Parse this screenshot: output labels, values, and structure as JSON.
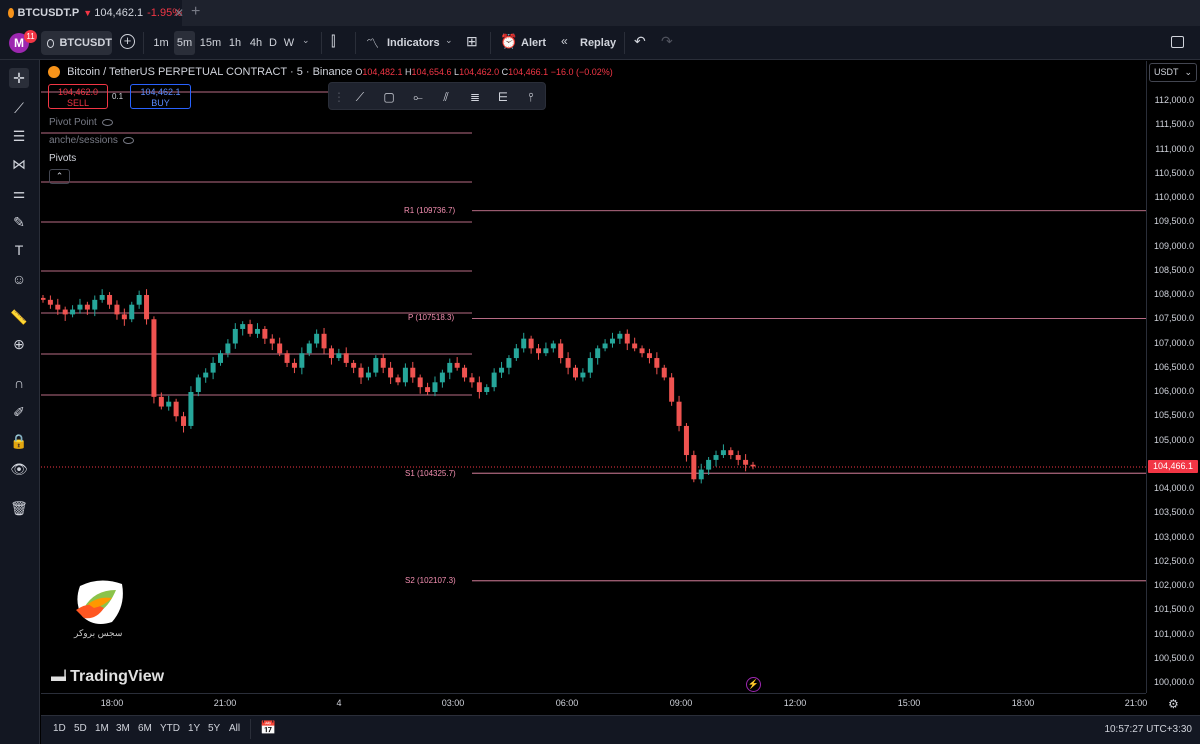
{
  "tab": {
    "symbol": "BTCUSDT.P",
    "price": "104,462.1",
    "change": "-1.95%"
  },
  "toolbar": {
    "avatar_letter": "M",
    "notification_count": "11",
    "symbol": "BTCUSDT",
    "intervals": [
      "1m",
      "5m",
      "15m",
      "1h",
      "4h",
      "D",
      "W"
    ],
    "active_interval": "5m",
    "indicators_label": "Indicators",
    "alert_label": "Alert",
    "replay_label": "Replay"
  },
  "legend": {
    "title": "Bitcoin / TetherUS PERPETUAL CONTRACT · 5 · Binance",
    "open_label": "O",
    "open": "104,482.1",
    "high_label": "H",
    "high": "104,654.6",
    "low_label": "L",
    "low": "104,462.0",
    "close_label": "C",
    "close": "104,466.1",
    "change": "−16.0 (−0.02%)"
  },
  "trade": {
    "sell_price": "104,462.0",
    "sell_label": "SELL",
    "buy_price": "104,462.1",
    "buy_label": "BUY",
    "quantity": "0.1"
  },
  "indicators": [
    "Pivot Point",
    "anche/sessions",
    "Pivots"
  ],
  "currency": "USDT",
  "current_price": "104,466.1",
  "pivots": [
    {
      "label": "R1 (109736.7)",
      "value": 109736.7
    },
    {
      "label": "P (107518.3)",
      "value": 107518.3
    },
    {
      "label": "S1 (104325.7)",
      "value": 104325.7
    },
    {
      "label": "S2 (102107.3)",
      "value": 102107.3
    }
  ],
  "chart_data": {
    "type": "candlestick",
    "title": "Bitcoin / TetherUS PERPETUAL CONTRACT · 5 · Binance",
    "y_ticks": [
      "112,000.0",
      "111,500.0",
      "111,000.0",
      "110,500.0",
      "110,000.0",
      "109,500.0",
      "109,000.0",
      "108,500.0",
      "108,000.0",
      "107,500.0",
      "107,000.0",
      "106,500.0",
      "106,000.0",
      "105,500.0",
      "105,000.0",
      "104,500.0",
      "104,000.0",
      "103,500.0",
      "103,000.0",
      "102,500.0",
      "102,000.0",
      "101,500.0",
      "101,000.0",
      "100,500.0",
      "100,000.0"
    ],
    "x_ticks": [
      "18:00",
      "21:00",
      "4",
      "03:00",
      "06:00",
      "09:00",
      "12:00",
      "15:00",
      "18:00",
      "21:00"
    ],
    "ylim": [
      99800,
      112300
    ],
    "close_series": [
      107900,
      107800,
      107700,
      107600,
      107700,
      107800,
      107700,
      107900,
      108000,
      107800,
      107600,
      107500,
      107800,
      108000,
      107500,
      105900,
      105700,
      105800,
      105500,
      105300,
      106000,
      106300,
      106400,
      106600,
      106800,
      107000,
      107300,
      107400,
      107200,
      107300,
      107100,
      107000,
      106800,
      106600,
      106500,
      106800,
      107000,
      107200,
      106900,
      106700,
      106800,
      106600,
      106500,
      106300,
      106400,
      106700,
      106500,
      106300,
      106200,
      106500,
      106300,
      106100,
      106000,
      106200,
      106400,
      106600,
      106500,
      106300,
      106200,
      106000,
      106100,
      106400,
      106500,
      106700,
      106900,
      107100,
      106900,
      106800,
      106900,
      107000,
      106700,
      106500,
      106300,
      106400,
      106700,
      106900,
      107000,
      107100,
      107200,
      107000,
      106900,
      106800,
      106700,
      106500,
      106300,
      105800,
      105300,
      104700,
      104200,
      104400,
      104600,
      104700,
      104800,
      104700,
      104600,
      104500,
      104466
    ]
  },
  "time_ranges": [
    "1D",
    "5D",
    "1M",
    "3M",
    "6M",
    "YTD",
    "1Y",
    "5Y",
    "All"
  ],
  "clock": "10:57:27 UTC+3:30",
  "watermark": {
    "brand": "TradingView",
    "badge_caption": "سجس بروکر"
  }
}
